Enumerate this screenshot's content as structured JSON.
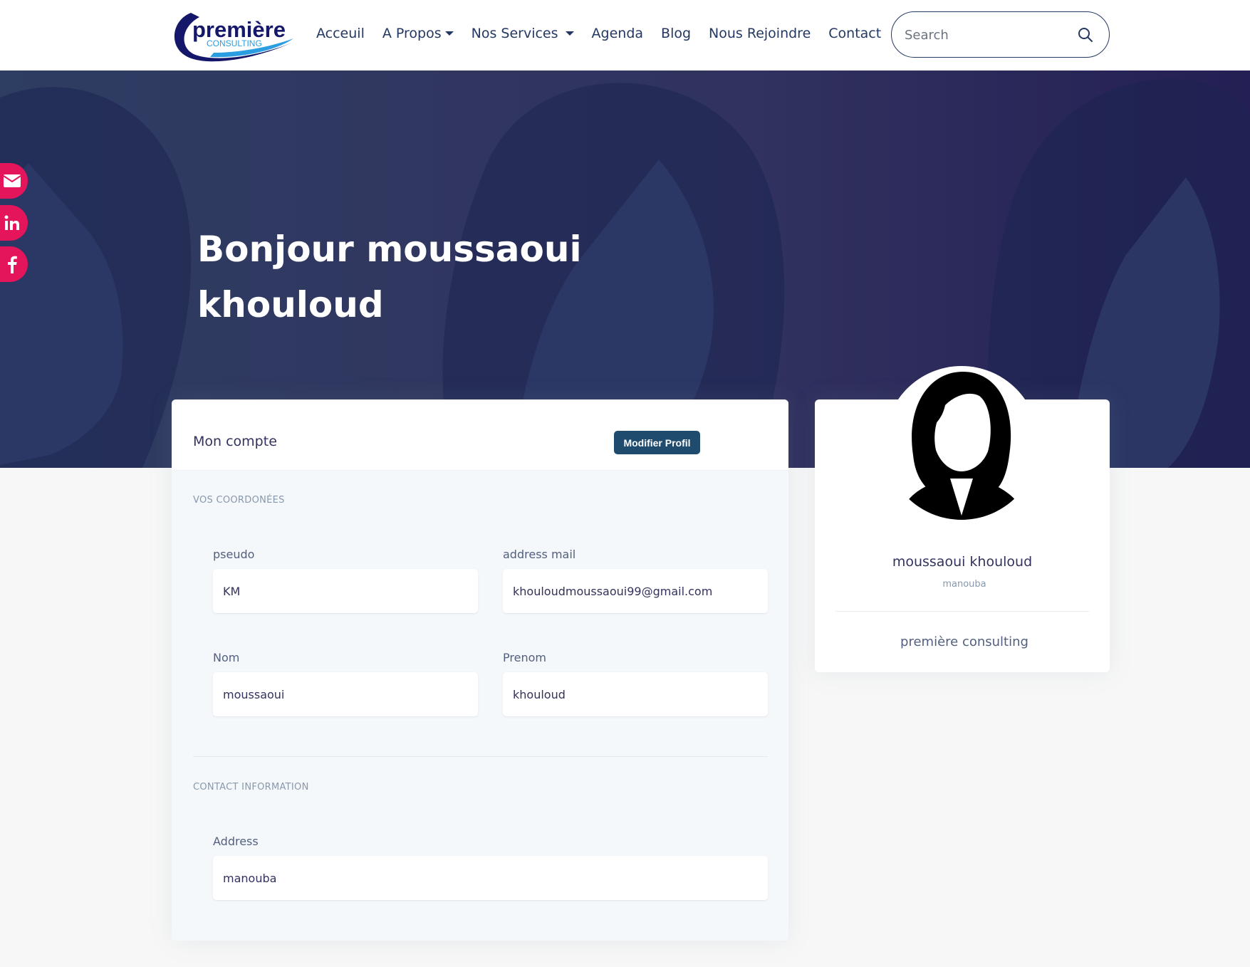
{
  "brand": {
    "logo_text_main": "première",
    "logo_text_sub": "CONSULTING"
  },
  "nav": {
    "items": [
      {
        "label": "Acceuil",
        "dropdown": false
      },
      {
        "label": "A Propos",
        "dropdown": true
      },
      {
        "label": "Nos Services",
        "dropdown": true
      },
      {
        "label": "Agenda",
        "dropdown": false
      },
      {
        "label": "Blog",
        "dropdown": false
      },
      {
        "label": "Nous Rejoindre",
        "dropdown": false
      },
      {
        "label": "Contact",
        "dropdown": false
      }
    ],
    "search_placeholder": "Search"
  },
  "social": {
    "icons": [
      "envelope-icon",
      "linkedin-icon",
      "facebook-icon"
    ],
    "color": "#e5155b"
  },
  "hero": {
    "title_line1": "Bonjour moussaoui",
    "title_line2": "khouloud"
  },
  "account": {
    "title": "Mon compte",
    "edit_button": "Modifier Profil",
    "section1": "VOS COORDONÉES",
    "section2": "CONTACT INFORMATION",
    "fields": {
      "pseudo": {
        "label": "pseudo",
        "value": "KM"
      },
      "email": {
        "label": "address mail",
        "value": "khouloudmoussaoui99@gmail.com"
      },
      "nom": {
        "label": "Nom",
        "value": "moussaoui"
      },
      "prenom": {
        "label": "Prenom",
        "value": "khouloud"
      },
      "address": {
        "label": "Address",
        "value": "manouba"
      }
    }
  },
  "profile": {
    "name": "moussaoui khouloud",
    "city": "manouba",
    "company": "première consulting"
  },
  "colors": {
    "nav_text": "#233862",
    "hero_bg": "#2e3d62",
    "button_bg": "#1f4b6e",
    "accent_pink": "#e5155b"
  }
}
